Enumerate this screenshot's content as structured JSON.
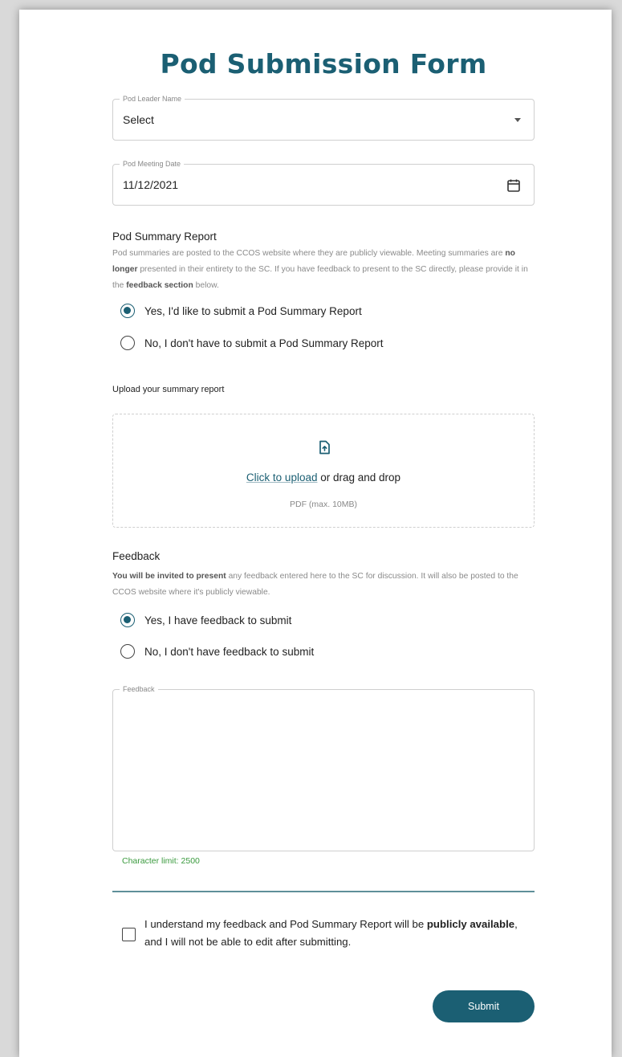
{
  "form": {
    "title": "Pod Submission Form",
    "leader_field": {
      "legend": "Pod Leader Name",
      "value": "Select"
    },
    "date_field": {
      "legend": "Pod Meeting Date",
      "value": "11/12/2021"
    },
    "summary": {
      "heading": "Pod Summary Report",
      "desc_part1": "Pod summaries are posted to the CCOS website where they are publicly viewable. Meeting summaries are ",
      "desc_bold1": "no longer",
      "desc_part2": " presented in their entirety to the SC. If you have feedback to present to the SC directly, please provide it in the ",
      "desc_bold2": "feedback section",
      "desc_part3": " below.",
      "options": [
        {
          "label": "Yes, I'd like to submit a Pod Summary Report",
          "checked": true
        },
        {
          "label": "No, I don't have to submit a Pod Summary Report",
          "checked": false
        }
      ]
    },
    "upload": {
      "label": "Upload your summary report",
      "link_text": "Click to upload",
      "rest_text": " or drag and drop",
      "hint": "PDF (max. 10MB)"
    },
    "feedback": {
      "heading": "Feedback",
      "desc_bold": "You will be invited to present",
      "desc_rest": " any feedback entered here to the SC for discussion. It will also be posted to the CCOS website where it's publicly viewable.",
      "options": [
        {
          "label": "Yes, I have feedback to submit",
          "checked": true
        },
        {
          "label": "No, I don't have feedback to submit",
          "checked": false
        }
      ],
      "textarea_legend": "Feedback",
      "textarea_value": "",
      "char_limit": "Character limit: 2500"
    },
    "acknowledge": {
      "part1": "I understand my feedback and Pod Summary Report will be ",
      "bold1": "publicly available",
      "part2": ", and I will not be able to edit after submitting.",
      "checked": false
    },
    "submit_label": "Submit"
  },
  "colors": {
    "accent": "#1b5f73",
    "char_limit": "#3a9a3e"
  }
}
